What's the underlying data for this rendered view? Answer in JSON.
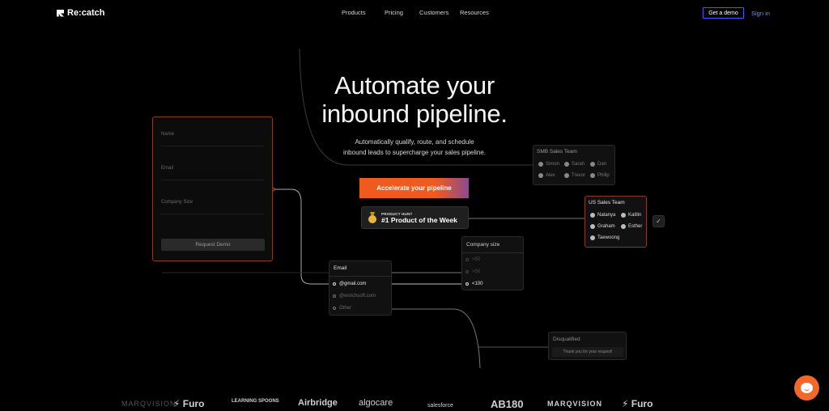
{
  "nav": {
    "brand": "Re:catch",
    "menu": [
      "Products",
      "Pricing",
      "Customers",
      "Resources"
    ],
    "cta": "Get a demo",
    "signin": "Sign in"
  },
  "hero": {
    "title_line1": "Automate your",
    "title_line2": "inbound pipeline.",
    "subtitle_line1": "Automatically qualify, route, and schedule",
    "subtitle_line2": "inbound leads to supercharge your sales pipeline.",
    "cta": "Accelerate your pipeline",
    "badge_small": "PRODUCT HUNT",
    "badge_big": "#1 Product of the Week"
  },
  "form": {
    "fields": [
      "Name",
      "Email",
      "Company Size"
    ],
    "button": "Request Demo"
  },
  "email_node": {
    "title": "Email",
    "options": [
      "@gmail.com",
      "@enrichsoft.com",
      "Other"
    ]
  },
  "size_node": {
    "title": "Company size",
    "options": [
      ">50",
      ">50",
      "<100"
    ]
  },
  "smb_team": {
    "title": "SMB Sales Team",
    "members": [
      "Simon",
      "Sarah",
      "Dan",
      "Alex",
      "Trevor",
      "Philip"
    ]
  },
  "us_team": {
    "title": "US Sales Team",
    "members": [
      "Natanya",
      "Kaitlin",
      "Graham",
      "Esther",
      "Taewoong"
    ]
  },
  "disqualified": {
    "title": "Disqualified",
    "message": "Thank you for your request!"
  },
  "logos": [
    "MARQVISION",
    "Furo",
    "LEARNING SPOONS",
    "Airbridge",
    "algocare",
    "salesforce",
    "AB180",
    "MARQVISION",
    "Furo"
  ],
  "colors": {
    "accent": "#ef5a1f",
    "link": "#6f8bff",
    "background": "#000000"
  }
}
